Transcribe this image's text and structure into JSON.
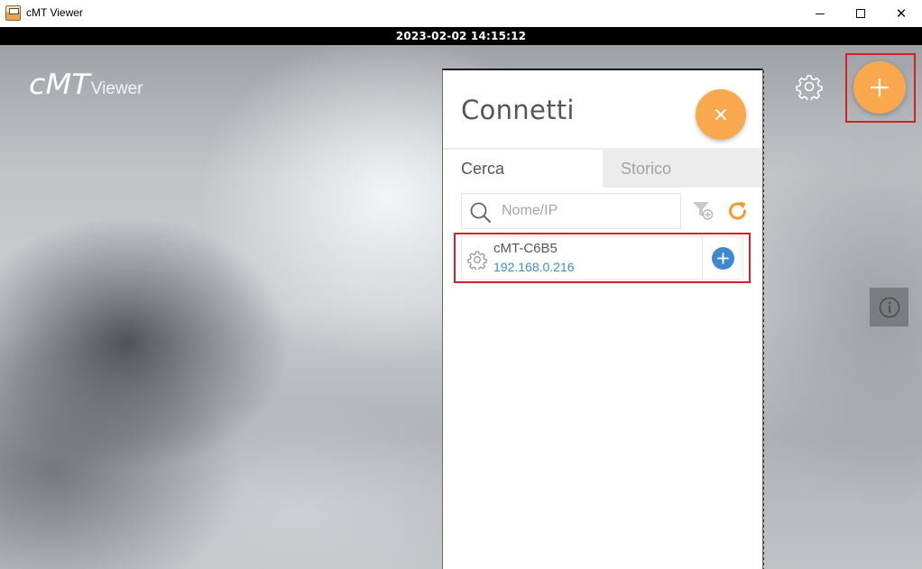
{
  "window": {
    "title": "cMT Viewer",
    "controls": {
      "minimize": "minimize-icon",
      "maximize": "maximize-icon",
      "close": "✕"
    }
  },
  "status_bar": {
    "datetime": "2023-02-02 14:15:12"
  },
  "brand": {
    "logo_main": "cMT",
    "logo_sub": "Viewer"
  },
  "toolbar": {
    "settings_icon": "gear-icon",
    "add_icon": "plus-icon",
    "info_icon": "info-icon"
  },
  "panel": {
    "title": "Connetti",
    "close_icon": "close-icon",
    "tabs": [
      {
        "label": "Cerca",
        "active": true
      },
      {
        "label": "Storico",
        "active": false
      }
    ],
    "search": {
      "placeholder": "Nome/IP",
      "value": ""
    },
    "filter_icon": "filter-add-icon",
    "refresh_icon": "refresh-icon",
    "devices": [
      {
        "name": "cMT-C6B5",
        "ip": "192.168.0.216"
      }
    ]
  },
  "colors": {
    "accent_orange": "#f9a84e",
    "ip_blue": "#3f8fd1",
    "add_blue": "#3f88d0",
    "highlight_red": "#d0202a"
  }
}
